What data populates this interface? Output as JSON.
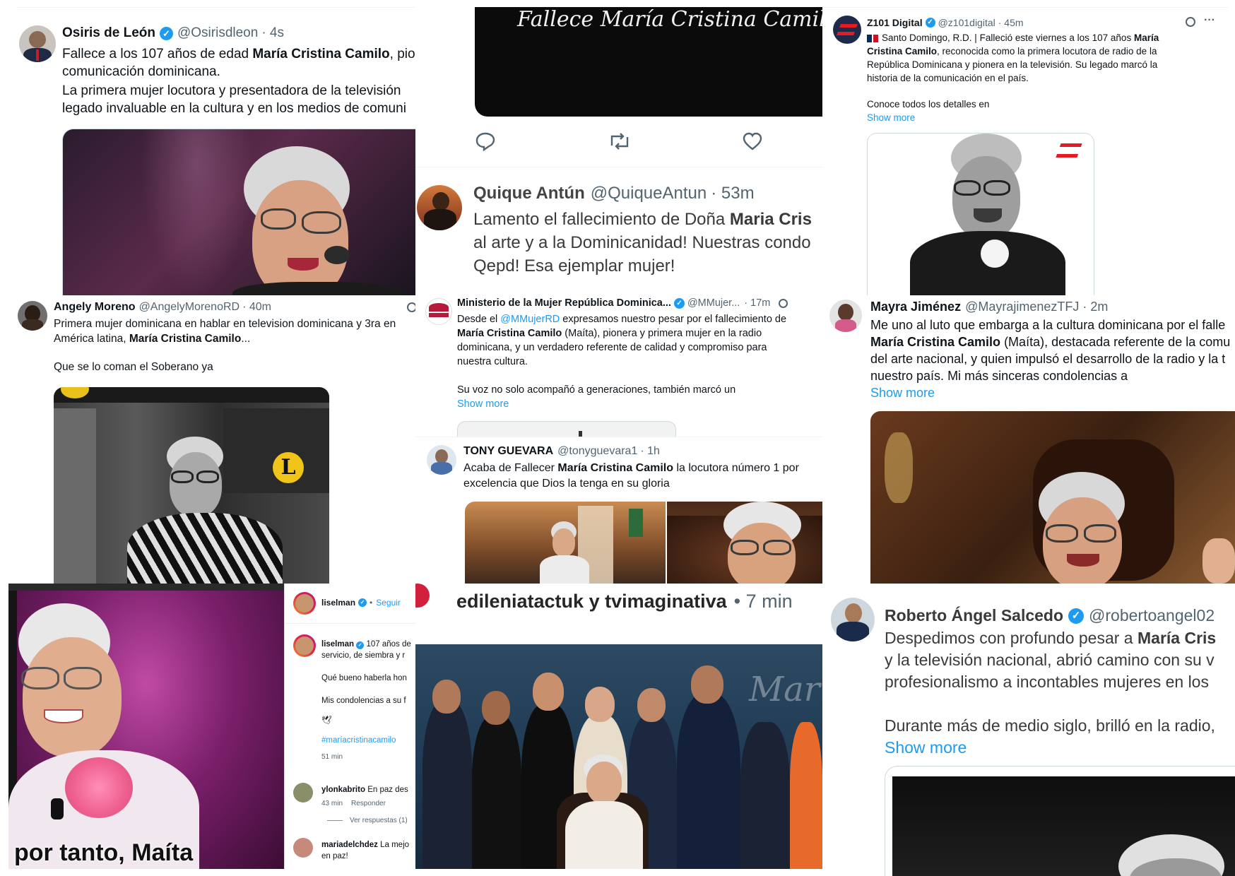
{
  "osiris": {
    "name": "Osiris de León",
    "handle": "@Osirisdleon",
    "time": "· 4s",
    "line1_pre": "Fallece a los 107 años de edad ",
    "line1_bold": "María Cristina Camilo",
    "line1_post": ", pio",
    "line2": "comunicación dominicana.",
    "line3": "La primera mujer locutora y presentadora de la televisión",
    "line4": "legado invaluable en la cultura y en los medios de comuni"
  },
  "video": {
    "caption": "Fallece María Cristina Camilo"
  },
  "quique": {
    "name": "Quique Antún",
    "handle": "@QuiqueAntun",
    "time": "· 53m",
    "line1_pre": "Lamento el fallecimiento de Doña ",
    "line1_bold": "Maria Cris",
    "line2": "al arte y a la Dominicanidad! Nuestras condo",
    "line3": "Qepd! Esa ejemplar mujer!"
  },
  "z101": {
    "name": "Z101 Digital",
    "handle": "@z101digital",
    "time": "· 45m",
    "line1_pre": "Santo Domingo, R.D. | Falleció este viernes a los 107 años ",
    "line1_bold": "María",
    "line2_bold": "Cristina Camilo",
    "line2_post": ", reconocida como la primera locutora de radio de la",
    "line3": "República Dominicana y pionera en la televisión. Su legado marcó la",
    "line4": "historia de la comunicación en el país.",
    "line5": "Conoce todos los detalles en",
    "show_more": "Show more",
    "more_icon": "···"
  },
  "angely": {
    "name": "Angely Moreno",
    "handle": "@AngelyMorenoRD",
    "time": "· 40m",
    "line1": "Primera mujer dominicana en hablar en television dominicana y 3ra en",
    "line2_pre": "América latina, ",
    "line2_bold": "María Cristina Camilo",
    "line2_post": "...",
    "line3": "Que se lo coman el Soberano ya",
    "logo_letter": "L"
  },
  "ministerio": {
    "name": "Ministerio de la Mujer República Dominica...",
    "handle": "@MMujer...",
    "time": "· 17m",
    "line1_pre": "Desde el ",
    "line1_link": "@MMujerRD",
    "line1_post": " expresamos nuestro pesar por el fallecimiento de",
    "line2_bold": "María Cristina Camilo",
    "line2_post": " (Maíta), pionera y primera mujer en la radio",
    "line3": "dominicana, y un verdadero referente de calidad y compromiso para",
    "line4": "nuestra cultura.",
    "line5": "Su voz no solo acompañó a generaciones, también marcó un",
    "show_more": "Show more"
  },
  "mayra": {
    "name": "Mayra Jiménez",
    "handle": "@MayrajimenezTFJ",
    "time": "· 2m",
    "line1": "Me uno al luto que embarga a la cultura dominicana por el falle",
    "line2_bold": "María Cristina Camilo",
    "line2_post": " (Maíta), destacada referente de la comu",
    "line3": "del arte nacional, y quien impulsó el desarrollo de la radio y la t",
    "line4": "nuestro país. Mi más sinceras condolencias a",
    "show_more": "Show more"
  },
  "tony": {
    "name": "TONY GUEVARA",
    "handle": "@tonyguevara1",
    "time": "· 1h",
    "line1_pre": "Acaba de Fallecer ",
    "line1_bold": "María Cristina Camilo",
    "line1_post": " la locutora número 1 por",
    "line2": "excelencia que Dios la tenga en su gloria"
  },
  "instagram": {
    "user": "liselman",
    "follow": "Seguir",
    "caption_user": "liselman",
    "caption_line1": "107 años de",
    "caption_line2": "servicio, de siembra y r",
    "comment1": "Qué bueno haberla hon",
    "comment2": "Mis condolencias a su f",
    "emoji": "🕊",
    "hashtag": "#maríacristinacamilo",
    "caption_time": "51 min",
    "reply_user": "ylonkabrito",
    "reply_text": "En paz des",
    "reply_time": "43 min",
    "reply_label": "Responder",
    "view_replies": "Ver respuestas (1)",
    "last_user": "mariadelchdez",
    "last_text": "La mejo",
    "last_line2": "en paz!",
    "meme_text": "por tanto, Maíta"
  },
  "collab": {
    "title": "edileniatactuk y tvimaginativa",
    "time": "• 7 min",
    "backdrop_text": "María"
  },
  "roberto": {
    "name": "Roberto Ángel Salcedo",
    "handle": "@robertoangel02",
    "line1_pre": "Despedimos con profundo pesar a ",
    "line1_bold": "María Cris",
    "line2": "y la televisión nacional, abrió camino con su v",
    "line3": "profesionalismo a incontables mujeres en los",
    "line4": "Durante más de medio siglo, brilló en la radio,",
    "show_more": "Show more"
  }
}
